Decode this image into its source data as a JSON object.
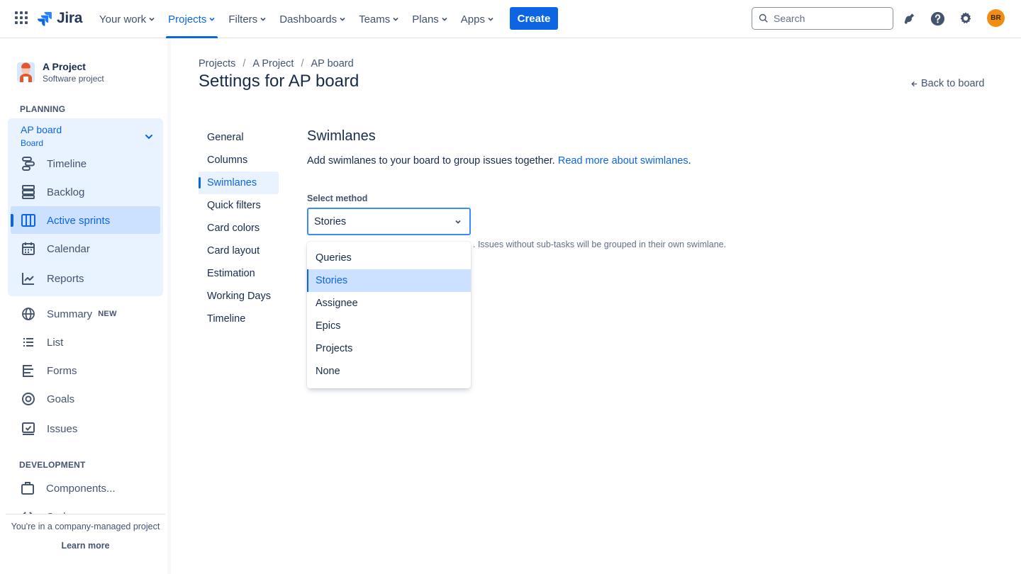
{
  "topnav": {
    "logo_text": "Jira",
    "items": [
      {
        "label": "Your work"
      },
      {
        "label": "Projects"
      },
      {
        "label": "Filters"
      },
      {
        "label": "Dashboards"
      },
      {
        "label": "Teams"
      },
      {
        "label": "Plans"
      },
      {
        "label": "Apps"
      }
    ],
    "active_item": "Projects",
    "create_label": "Create",
    "search_placeholder": "Search",
    "avatar_initials": "BR",
    "accent_color": "#0c66e4",
    "avatar_color": "#f18d13"
  },
  "sidebar": {
    "project_name": "A Project",
    "project_type": "Software project",
    "planning_label": "PLANNING",
    "board_name": "AP board",
    "board_sub": "Board",
    "planning_items": [
      {
        "label": "Timeline",
        "icon": "timeline-icon"
      },
      {
        "label": "Backlog",
        "icon": "backlog-icon"
      },
      {
        "label": "Active sprints",
        "icon": "board-icon"
      },
      {
        "label": "Calendar",
        "icon": "calendar-icon"
      },
      {
        "label": "Reports",
        "icon": "reports-icon"
      }
    ],
    "other_items": [
      {
        "label": "Summary",
        "icon": "globe-icon",
        "badge": "NEW"
      },
      {
        "label": "List",
        "icon": "list-icon"
      },
      {
        "label": "Forms",
        "icon": "forms-icon"
      },
      {
        "label": "Goals",
        "icon": "goals-icon"
      },
      {
        "label": "Issues",
        "icon": "issues-icon"
      }
    ],
    "development_label": "DEVELOPMENT",
    "development_items": [
      {
        "label": "Components...",
        "icon": "components-icon"
      },
      {
        "label": "Code",
        "icon": "code-icon"
      }
    ],
    "footer_text": "You're in a company-managed project",
    "footer_link": "Learn more"
  },
  "main": {
    "breadcrumb": [
      "Projects",
      "A Project",
      "AP board"
    ],
    "title": "Settings for AP board",
    "back_link": "Back to board",
    "settings_nav": [
      {
        "label": "General"
      },
      {
        "label": "Columns"
      },
      {
        "label": "Swimlanes"
      },
      {
        "label": "Quick filters"
      },
      {
        "label": "Card colors"
      },
      {
        "label": "Card layout"
      },
      {
        "label": "Estimation"
      },
      {
        "label": "Working Days"
      },
      {
        "label": "Timeline"
      }
    ],
    "active_settings_item": "Swimlanes",
    "section_title": "Swimlanes",
    "section_desc": "Add swimlanes to your board to group issues together.",
    "section_link": "Read more about swimlanes",
    "section_desc_end": ".",
    "field_label": "Select method",
    "select_value": "Stories",
    "help_text": ". Issues without sub-tasks will be grouped in their own swimlane.",
    "dropdown_options": [
      {
        "label": "Queries"
      },
      {
        "label": "Stories"
      },
      {
        "label": "Assignee"
      },
      {
        "label": "Epics"
      },
      {
        "label": "Projects"
      },
      {
        "label": "None"
      }
    ],
    "dropdown_selected": "Stories"
  }
}
